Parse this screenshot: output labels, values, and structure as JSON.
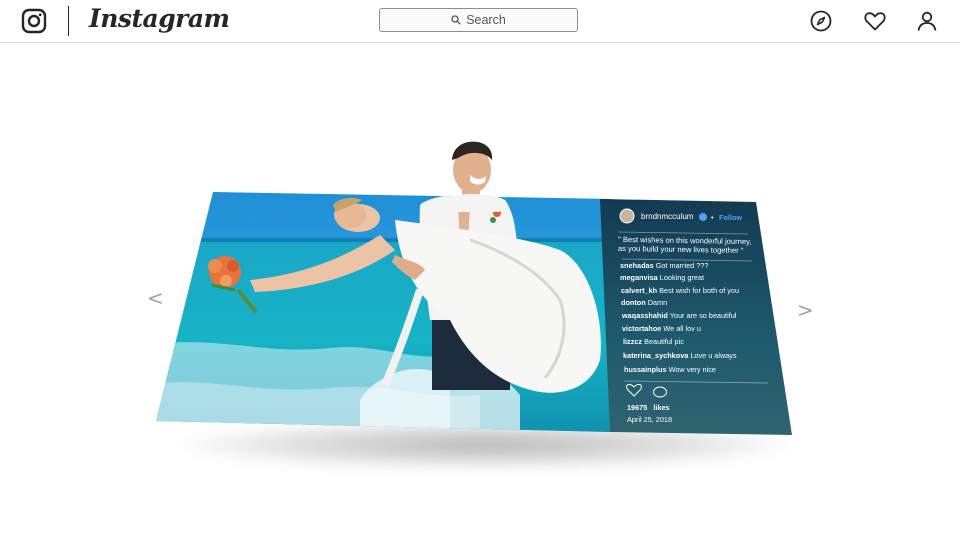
{
  "header": {
    "wordmark": "Instagram",
    "search_placeholder": "Search",
    "icons": [
      "instagram-logo-icon",
      "compass-icon",
      "heart-icon",
      "profile-icon"
    ]
  },
  "carousel": {
    "prev": "<",
    "next": ">"
  },
  "post": {
    "username": "brndnmcculum",
    "follow_label": "Follow",
    "caption": "\" Best wishes on this wonderful journey, as you build your new lives together \"",
    "comments": [
      {
        "user": "snehadas",
        "text": "Got married ???"
      },
      {
        "user": "meganvisa",
        "text": "Looking great"
      },
      {
        "user": "calvert_kh",
        "text": "Best wish for both of you"
      },
      {
        "user": "donton",
        "text": "Damn"
      },
      {
        "user": "waqasshahid",
        "text": "Your are so beautiful"
      },
      {
        "user": "victortahoe",
        "text": "We all lov u"
      },
      {
        "user": "lizzcz",
        "text": "Beautiful pic"
      },
      {
        "user": "katerina_sychkova",
        "text": "Love u always"
      },
      {
        "user": "hussainplus",
        "text": "Wow very nice"
      }
    ],
    "likes_count": "19675",
    "likes_label": "likes",
    "date": "April 25, 2018"
  },
  "colors": {
    "link": "#4aa3f0",
    "panel": "#1f4e63",
    "sea": "#1aa2c6"
  }
}
